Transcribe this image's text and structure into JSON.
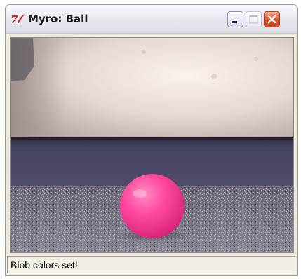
{
  "window": {
    "title": "Myro: Ball",
    "icon": "tk-feather-icon",
    "accent_close": "#d9532d"
  },
  "titlebar_buttons": {
    "minimize": "minimize-icon",
    "maximize": "maximize-icon",
    "close": "close-icon"
  },
  "camera_view": {
    "colors": {
      "wall": "#e9ddd6",
      "baseboard": "#4a4964",
      "carpet": "#7b7887",
      "ball": "#ff3f9a"
    }
  },
  "status": {
    "text": "Blob colors set!"
  }
}
